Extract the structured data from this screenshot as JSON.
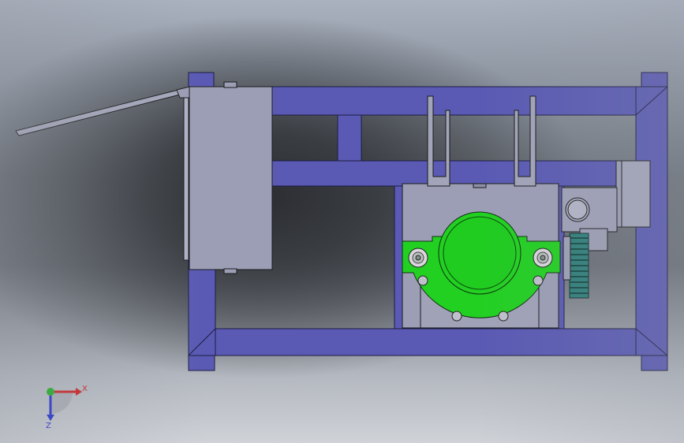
{
  "app": {
    "view": "top-view",
    "model": "frame-gearbox-assembly"
  },
  "colors": {
    "frame": "#5a5ab4",
    "frame_edge": "#1c1c40",
    "housing": "#9c9eb6",
    "gear_green": "#1fd11f",
    "gear_teal": "#2f7f7a",
    "outline": "#1a1a1a"
  },
  "triad": {
    "x_label": "X",
    "z_label": "Z",
    "x_color": "#d11c1c",
    "y_color": "#1fb01f",
    "z_color": "#1c2ad1"
  }
}
